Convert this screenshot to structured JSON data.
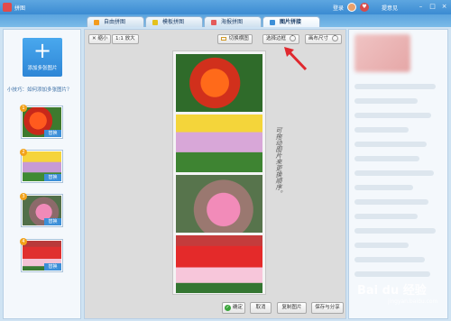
{
  "app": {
    "title": "拼图"
  },
  "titlebar": {
    "login": "登录",
    "feedback": "提意见"
  },
  "tabs": [
    {
      "label": "自由拼图"
    },
    {
      "label": "模板拼图"
    },
    {
      "label": "海报拼图"
    },
    {
      "label": "图片拼接"
    }
  ],
  "left_panel": {
    "add_button": "添加多张图片",
    "tip": "小技巧：如何添加多张图片？",
    "thumbs": [
      {
        "num": "1",
        "replace": "替换"
      },
      {
        "num": "2",
        "replace": "替换"
      },
      {
        "num": "3",
        "replace": "替换"
      },
      {
        "num": "4",
        "replace": "替换"
      }
    ]
  },
  "toolbar": {
    "shrink": "缩小",
    "zoom_ratio": "1:1",
    "enlarge": "放大",
    "switch_layout": "切换横图",
    "select_border": "选择边框",
    "canvas_size": "画布尺寸"
  },
  "annotation": "可拖动图片来更换顺序。",
  "bottom": {
    "ok": "确定",
    "cancel": "取消",
    "copy": "复制图片",
    "save_share": "保存与分享"
  },
  "watermark": {
    "main": "Bai du 经验",
    "sub": "jingyan.baidu.com"
  },
  "colors": {
    "titlebar": "#3b8bd2",
    "add_button": "#2e86d6",
    "arrow": "#e0282e"
  }
}
